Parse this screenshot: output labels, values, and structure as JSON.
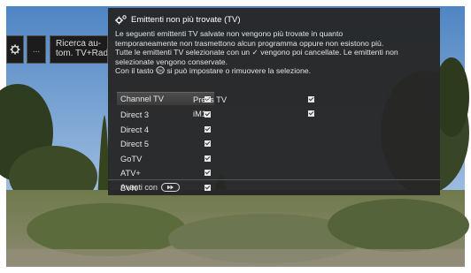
{
  "left_menu": {
    "gear_icon": "gear-icon",
    "more_label": "...",
    "search_label_line1": "Ricerca au-",
    "search_label_line2": "tom. TV+Radi"
  },
  "dialog": {
    "title": "Emittenti non più trovate (TV)",
    "title_icon": "settings-gear-icon",
    "text": [
      "Le seguenti emittenti TV salvate non vengono più trovate in quanto",
      "temporaneamente non trasmettono alcun programma oppure non esistono più.",
      "Tutte le emittenti TV selezionate con un ✓ vengono poi cancellate. Le emittenti non",
      "selezionate vengono conservate."
    ],
    "ok_line_before": "Con il tasto",
    "ok_line_after": "si può impostare o rimuovere la selezione.",
    "ok_key_icon": "ok-button-icon",
    "channels_col1": [
      {
        "name": "Channel TV",
        "checked": true,
        "selected": true
      },
      {
        "name": "Direct 3",
        "checked": true,
        "selected": false
      },
      {
        "name": "Direct 4",
        "checked": true,
        "selected": false
      },
      {
        "name": "Direct 5",
        "checked": true,
        "selected": false
      },
      {
        "name": "GoTV",
        "checked": true,
        "selected": false
      },
      {
        "name": "ATV+",
        "checked": true,
        "selected": false
      },
      {
        "name": "BVN",
        "checked": true,
        "selected": false
      }
    ],
    "channels_col2": [
      {
        "name": "Press TV",
        "checked": true
      },
      {
        "name": "iM1",
        "checked": true
      }
    ],
    "footer_label": "Avanti con",
    "footer_key_icon": "fast-forward-button-icon"
  }
}
